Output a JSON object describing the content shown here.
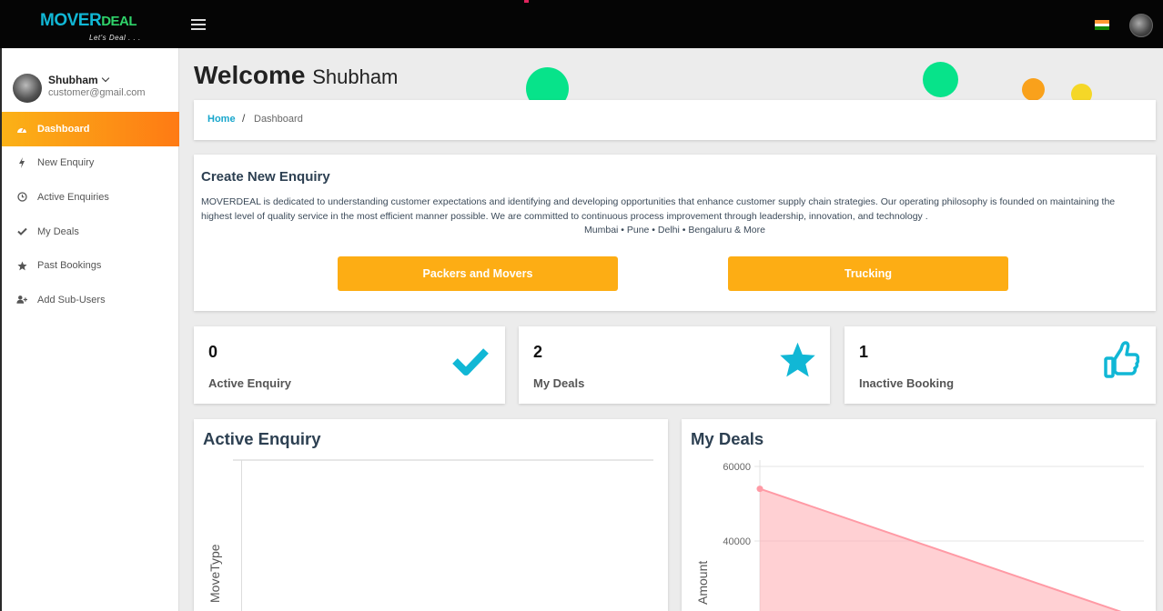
{
  "app": {
    "logo_text_main": "MOVER",
    "logo_text_deal": "DEAL",
    "logo_tagline": "Let's Deal . . ."
  },
  "sidebar": {
    "user_name": "Shubham",
    "user_email": "customer@gmail.com",
    "items": [
      {
        "label": "Dashboard",
        "icon": "dashboard-icon",
        "active": true
      },
      {
        "label": "New Enquiry",
        "icon": "bolt-icon",
        "active": false
      },
      {
        "label": "Active Enquiries",
        "icon": "clock-icon",
        "active": false
      },
      {
        "label": "My Deals",
        "icon": "check-icon",
        "active": false
      },
      {
        "label": "Past Bookings",
        "icon": "star-icon",
        "active": false
      },
      {
        "label": "Add Sub-Users",
        "icon": "user-plus-icon",
        "active": false
      }
    ]
  },
  "header": {
    "welcome": "Welcome",
    "user_name": "Shubham"
  },
  "breadcrumb": {
    "home": "Home",
    "separator": "/",
    "current": "Dashboard"
  },
  "enquiry": {
    "title": "Create New Enquiry",
    "description": "MOVERDEAL is dedicated to understanding customer expectations and identifying and developing opportunities that enhance customer supply chain strategies. Our operating philosophy is founded on maintaining the highest level of quality service in the most efficient manner possible. We are committed to continuous process improvement through leadership, innovation, and technology .",
    "cities": "Mumbai • Pune • Delhi • Bengaluru & More",
    "btn_packers": "Packers and Movers",
    "btn_trucking": "Trucking"
  },
  "stats": [
    {
      "value": "0",
      "label": "Active Enquiry",
      "icon": "check-icon"
    },
    {
      "value": "2",
      "label": "My Deals",
      "icon": "star-icon"
    },
    {
      "value": "1",
      "label": "Inactive Booking",
      "icon": "thumbs-up-icon"
    }
  ],
  "colors": {
    "accent_orange": "#fdad14",
    "accent_cyan": "#11b7d5",
    "bubble_green": "#07e38a",
    "bubble_orange": "#f9a11b",
    "bubble_yellow": "#f5d727"
  },
  "chart_data": [
    {
      "type": "bar",
      "title": "Active Enquiry",
      "ylabel": "MoveType",
      "series": []
    },
    {
      "type": "area",
      "title": "My Deals",
      "ylabel": "Amount",
      "yticks": [
        "60000",
        "40000"
      ],
      "ylim": [
        20000,
        60000
      ],
      "series": [
        {
          "values": [
            54000,
            20000
          ]
        }
      ]
    }
  ]
}
